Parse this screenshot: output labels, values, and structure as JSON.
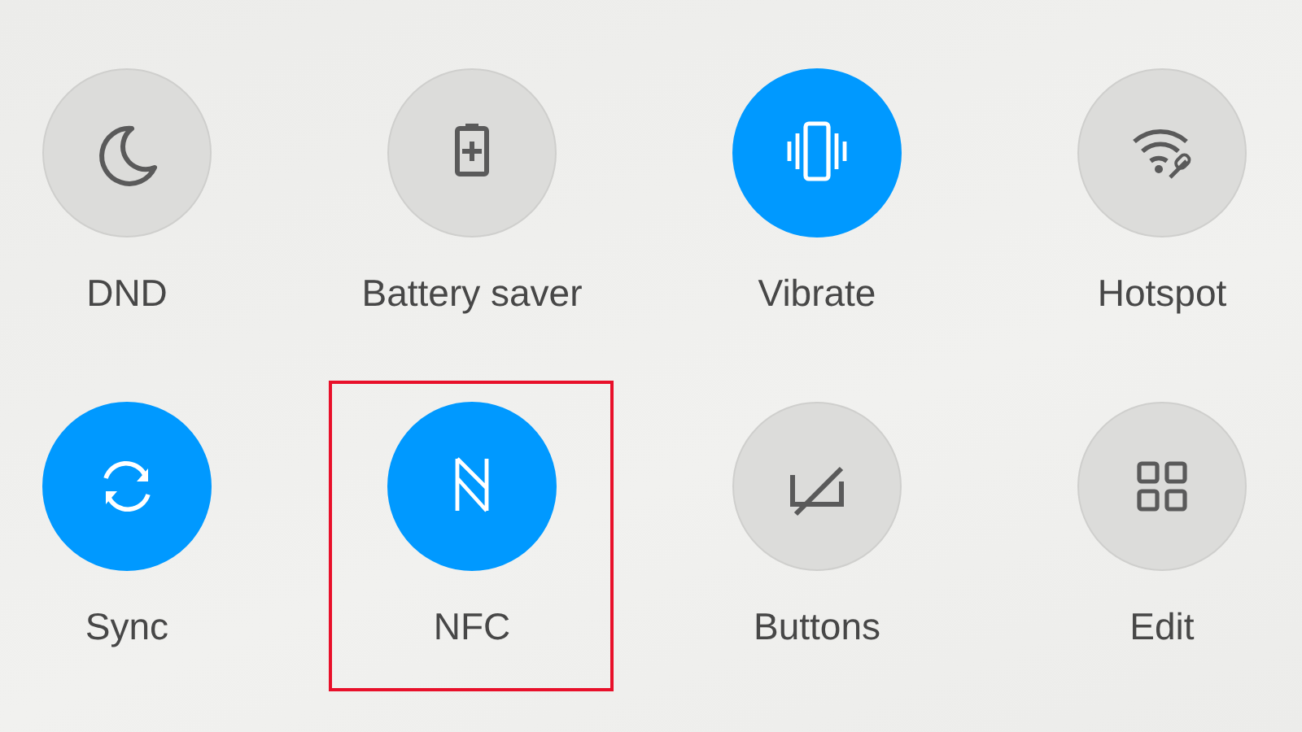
{
  "tiles": [
    {
      "label": "DND",
      "kind": "moon",
      "on": false,
      "highlighted": false
    },
    {
      "label": "Battery saver",
      "kind": "battery",
      "on": false,
      "highlighted": false
    },
    {
      "label": "Vibrate",
      "kind": "vibrate",
      "on": true,
      "highlighted": false
    },
    {
      "label": "Hotspot",
      "kind": "hotspot",
      "on": false,
      "highlighted": false
    },
    {
      "label": "Sync",
      "kind": "sync",
      "on": true,
      "highlighted": false
    },
    {
      "label": "NFC",
      "kind": "nfc",
      "on": true,
      "highlighted": true
    },
    {
      "label": "Buttons",
      "kind": "buttons",
      "on": false,
      "highlighted": false
    },
    {
      "label": "Edit",
      "kind": "edit",
      "on": false,
      "highlighted": false
    }
  ]
}
